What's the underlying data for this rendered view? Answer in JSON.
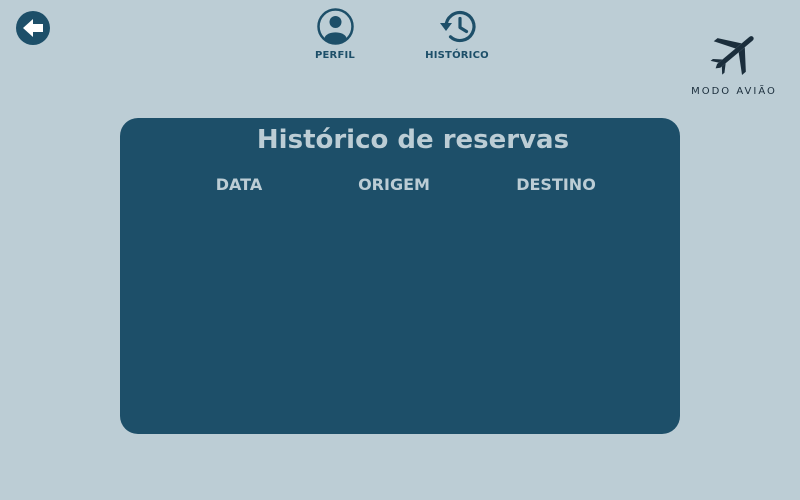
{
  "nav": {
    "back_icon": "arrow-left-icon",
    "items": [
      {
        "label": "PERFIL",
        "icon": "user-circle-icon"
      },
      {
        "label": "HISTÓRICO",
        "icon": "history-icon"
      }
    ]
  },
  "brand": {
    "name": "MODO AVIÃO",
    "icon": "airplane-icon"
  },
  "history": {
    "title": "Histórico de reservas",
    "columns": [
      "DATA",
      "ORIGEM",
      "DESTINO"
    ],
    "rows": []
  },
  "colors": {
    "background": "#bccdd5",
    "panel": "#1d4f69",
    "panel_text": "#bccdd5",
    "nav_text": "#1d4f69",
    "brand_text": "#1b2e3c"
  }
}
